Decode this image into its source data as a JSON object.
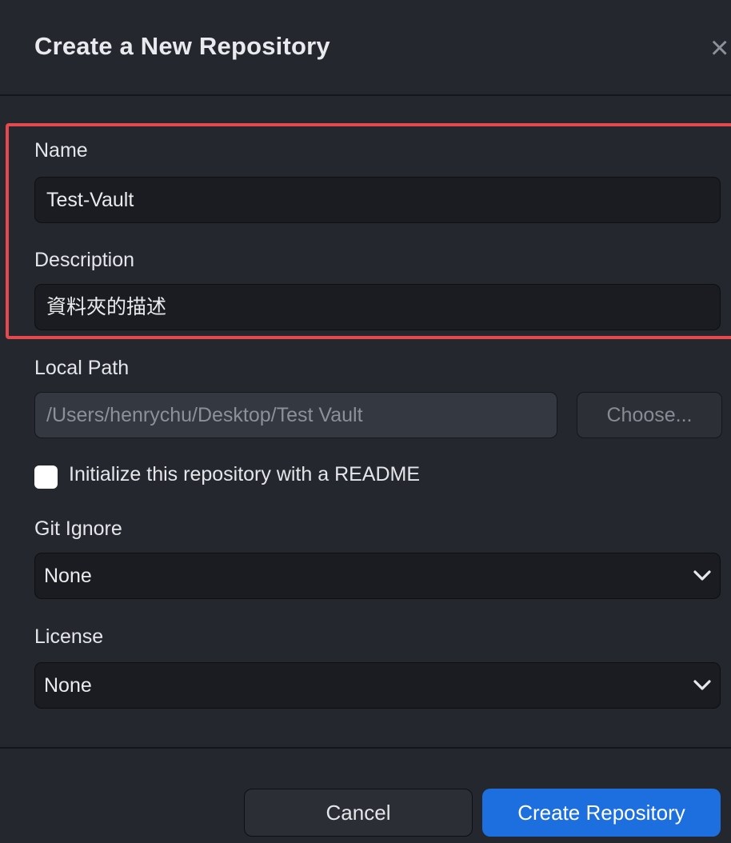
{
  "dialog": {
    "title": "Create a New Repository",
    "close_glyph": "×"
  },
  "form": {
    "name": {
      "label": "Name",
      "value": "Test-Vault"
    },
    "description": {
      "label": "Description",
      "value": "資料夾的描述"
    },
    "local_path": {
      "label": "Local Path",
      "value": "/Users/henrychu/Desktop/Test Vault",
      "choose_label": "Choose..."
    },
    "readme": {
      "label": "Initialize this repository with a README",
      "checked": false
    },
    "git_ignore": {
      "label": "Git Ignore",
      "value": "None"
    },
    "license": {
      "label": "License",
      "value": "None"
    }
  },
  "footer": {
    "cancel_label": "Cancel",
    "create_label": "Create Repository"
  },
  "colors": {
    "background": "#24272e",
    "input_background": "#1a1c21",
    "highlight_border": "#e5484d",
    "primary_button": "#1d6fe0"
  },
  "icons": {
    "close": "close-icon",
    "select_chevron": "chevron-down-icon"
  }
}
